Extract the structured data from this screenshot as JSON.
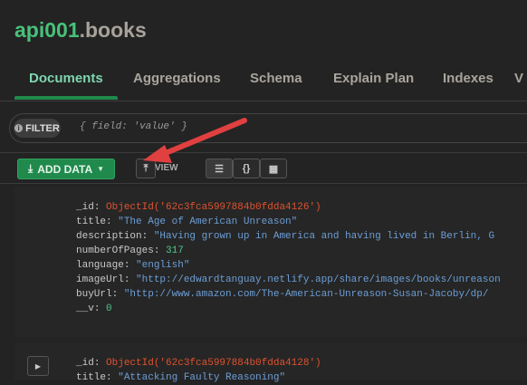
{
  "header": {
    "db": "api001",
    "collection": ".books"
  },
  "tabs": [
    "Documents",
    "Aggregations",
    "Schema",
    "Explain Plan",
    "Indexes",
    "V"
  ],
  "filter": {
    "label": "FILTER",
    "placeholder": "{ field: 'value' }"
  },
  "toolbar": {
    "add_data": "ADD DATA",
    "view_label": "VIEW",
    "view_json": "{}"
  },
  "documents": [
    {
      "fields": [
        {
          "key": "_id",
          "value": "ObjectId('62c3fca5997884b0fdda4126')",
          "type": "oid"
        },
        {
          "key": "title",
          "value": "\"The Age of American Unreason\"",
          "type": "str"
        },
        {
          "key": "description",
          "value": "\"Having grown up in America and having lived in Berlin, G",
          "type": "str"
        },
        {
          "key": "numberOfPages",
          "value": "317",
          "type": "num"
        },
        {
          "key": "language",
          "value": "\"english\"",
          "type": "str"
        },
        {
          "key": "imageUrl",
          "value": "\"http://edwardtanguay.netlify.app/share/images/books/unreason",
          "type": "str"
        },
        {
          "key": "buyUrl",
          "value": "\"http://www.amazon.com/The-American-Unreason-Susan-Jacoby/dp/",
          "type": "str"
        },
        {
          "key": "__v",
          "value": "0",
          "type": "num"
        }
      ]
    },
    {
      "fields": [
        {
          "key": "_id",
          "value": "ObjectId('62c3fca5997884b0fdda4128')",
          "type": "oid"
        },
        {
          "key": "title",
          "value": "\"Attacking Faulty Reasoning\"",
          "type": "str"
        }
      ]
    }
  ],
  "colors": {
    "accent": "#1f8a4c",
    "arrow": "#e04040"
  }
}
